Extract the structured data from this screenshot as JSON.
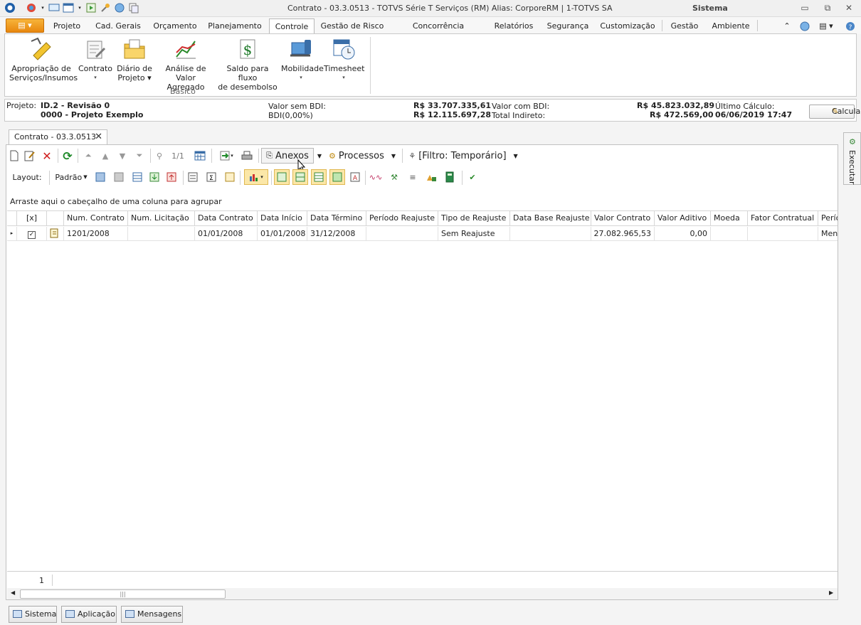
{
  "window": {
    "title": "Contrato - 03.3.0513 - TOTVS Série T Serviços (RM) Alias: CorporeRM | 1-TOTVS SA",
    "section": "Sistema",
    "controls": [
      "▭",
      "⧉",
      "✕"
    ]
  },
  "ribbon_tabs": [
    "Projeto",
    "Cad. Gerais",
    "Orçamento",
    "Planejamento",
    "Controle",
    "Gestão de Risco",
    "Concorrência Eletrônica",
    "Relatórios",
    "Segurança",
    "Customização",
    "Gestão",
    "Ambiente"
  ],
  "active_tab": "Controle",
  "ribbon_buttons": [
    {
      "line1": "Apropriação de",
      "line2": "Serviços/Insumos",
      "icon": "pencil-stack-icon"
    },
    {
      "line1": "Contrato",
      "line2": "▾",
      "icon": "contract-icon"
    },
    {
      "line1": "Diário de",
      "line2": "Projeto ▾",
      "icon": "folder-icon"
    },
    {
      "line1": "Análise de",
      "line2": "Valor Agregado",
      "icon": "chart-icon"
    },
    {
      "line1": "Saldo para fluxo",
      "line2": "de desembolso",
      "icon": "dollar-icon"
    },
    {
      "line1": "Mobilidade",
      "line2": "▾",
      "icon": "mobile-icon"
    },
    {
      "line1": "Timesheet",
      "line2": "▾",
      "icon": "calendar-clock-icon"
    }
  ],
  "ribbon_group_label": "Básico",
  "project": {
    "label": "Projeto:",
    "id_revision": "ID.2 - Revisão 0",
    "name": "0000 - Projeto Exemplo",
    "valor_sem_bdi_label": "Valor sem BDI:",
    "valor_sem_bdi": "R$ 33.707.335,61",
    "bdi_label": "BDI(0,00%)",
    "bdi_value": "R$ 12.115.697,28",
    "valor_com_bdi_label": "Valor com BDI:",
    "valor_com_bdi": "R$ 45.823.032,89",
    "total_indireto_label": "Total Indireto:",
    "total_indireto": "R$ 472.569,00",
    "ultimo_calculo_label": "Último Cálculo:",
    "ultimo_calculo": "06/06/2019 17:47",
    "calcular_label": "Calcular"
  },
  "doc_tab": {
    "label": "Contrato - 03.3.0513",
    "close": "✕"
  },
  "toolbar": {
    "page_indicator": "1/1",
    "anexos_label": "Anexos",
    "processos_label": "Processos",
    "filter_label": "[Filtro: Temporário]",
    "layout_label": "Layout:",
    "layout_value": "Padrão"
  },
  "group_hint": "Arraste aqui o cabeçalho de uma coluna para agrupar",
  "grid": {
    "columns": [
      "[x]",
      "",
      "Num. Contrato",
      "Num. Licitação",
      "Data Contrato",
      "Data Início",
      "Data Término",
      "Período Reajuste",
      "Tipo de Reajuste",
      "Data Base Reajuste",
      "Valor Contrato",
      "Valor Aditivo",
      "Moeda",
      "Fator Contratual",
      "Perío"
    ],
    "rows": [
      {
        "checked": "✓",
        "num_contrato": "1201/2008",
        "num_licitacao": "",
        "data_contrato": "01/01/2008",
        "data_inicio": "01/01/2008",
        "data_termino": "31/12/2008",
        "periodo_reajuste": "",
        "tipo_reajuste": "Sem Reajuste",
        "data_base_reajuste": "",
        "valor_contrato": "27.082.965,53",
        "valor_aditivo": "0,00",
        "moeda": "",
        "fator_contratual": "",
        "periodo": "Mens"
      }
    ],
    "row_count": "1"
  },
  "side_pane": {
    "label": "Executar"
  },
  "bottom_tabs": [
    "Sistema",
    "Aplicação",
    "Mensagens"
  ],
  "colors": {
    "accent_orange": "#e8870e",
    "border": "#c1c1c1"
  }
}
